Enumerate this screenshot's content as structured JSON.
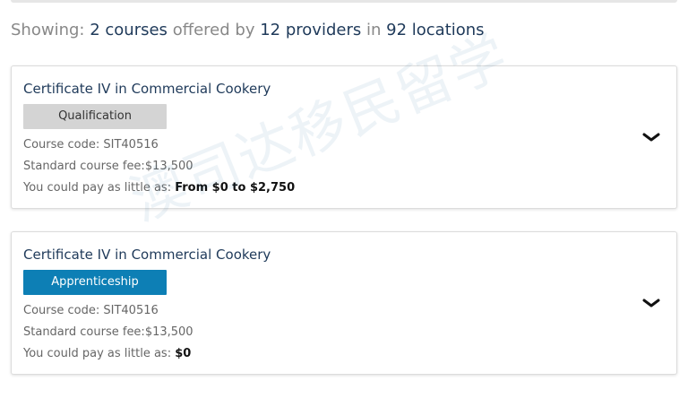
{
  "summary": {
    "prefix": "Showing:",
    "courses_count": "2",
    "courses_label": "courses",
    "offered_by": "offered by",
    "providers_count": "12",
    "providers_label": "providers",
    "in_label": "in",
    "locations_count": "92",
    "locations_label": "locations"
  },
  "courses": [
    {
      "title": "Certificate IV in Commercial Cookery",
      "badge": "Qualification",
      "code_line": "Course code: SIT40516",
      "fee_line": "Standard course fee:$13,500",
      "pay_label": "You could pay as little as:",
      "pay_amount": "From $0 to $2,750",
      "expand_icon": "chevron-down-icon"
    },
    {
      "title": "Certificate IV in Commercial Cookery",
      "badge": "Apprenticeship",
      "code_line": "Course code: SIT40516",
      "fee_line": "Standard course fee:$13,500",
      "pay_label": "You could pay as little as:",
      "pay_amount": "$0",
      "expand_icon": "chevron-down-icon"
    }
  ],
  "watermark": "澳司达移民留学",
  "colors": {
    "title": "#1f3a5a",
    "badge_qualification": "#d4d4d4",
    "badge_apprenticeship": "#0d7fb5"
  }
}
